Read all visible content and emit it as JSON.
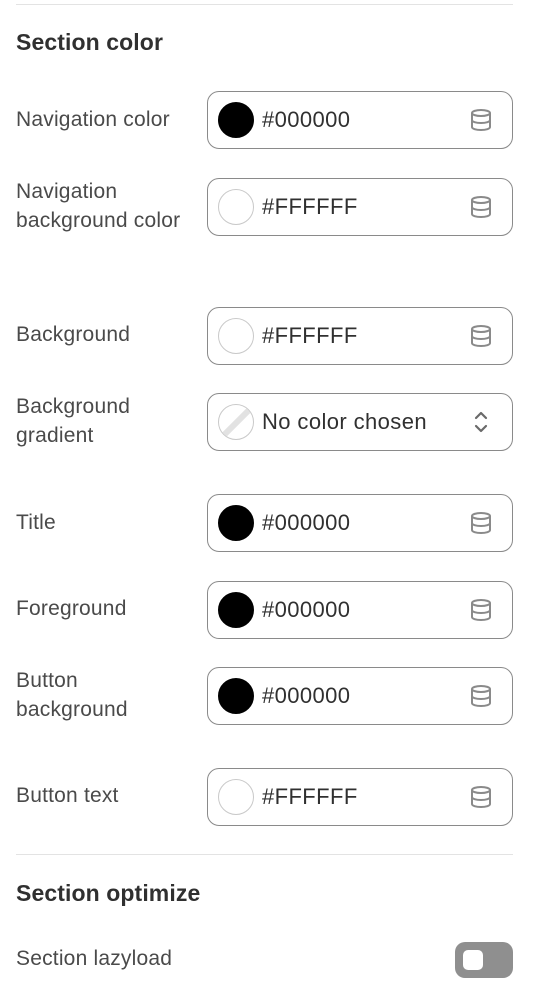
{
  "section_color": {
    "title": "Section color",
    "fields": [
      {
        "label": "Navigation color",
        "value": "#000000",
        "swatch": "#000000",
        "icon": "database-icon"
      },
      {
        "label": "Navigation background color",
        "value": "#FFFFFF",
        "swatch": "#FFFFFF",
        "icon": "database-icon"
      },
      {
        "label": "Background",
        "value": "#FFFFFF",
        "swatch": "#FFFFFF",
        "icon": "database-icon"
      },
      {
        "label": "Background gradient",
        "value": "No color chosen",
        "swatch": "none",
        "icon": "chevron-up-down-icon"
      },
      {
        "label": "Title",
        "value": "#000000",
        "swatch": "#000000",
        "icon": "database-icon"
      },
      {
        "label": "Foreground",
        "value": "#000000",
        "swatch": "#000000",
        "icon": "database-icon"
      },
      {
        "label": "Button background",
        "value": "#000000",
        "swatch": "#000000",
        "icon": "database-icon"
      },
      {
        "label": "Button text",
        "value": "#FFFFFF",
        "swatch": "#FFFFFF",
        "icon": "database-icon"
      }
    ]
  },
  "section_optimize": {
    "title": "Section optimize",
    "lazyload": {
      "label": "Section lazyload",
      "enabled": false
    }
  },
  "colors": {
    "border": "#8a8a8a",
    "toggle_off": "#8f8f8f",
    "text": "#303030"
  }
}
